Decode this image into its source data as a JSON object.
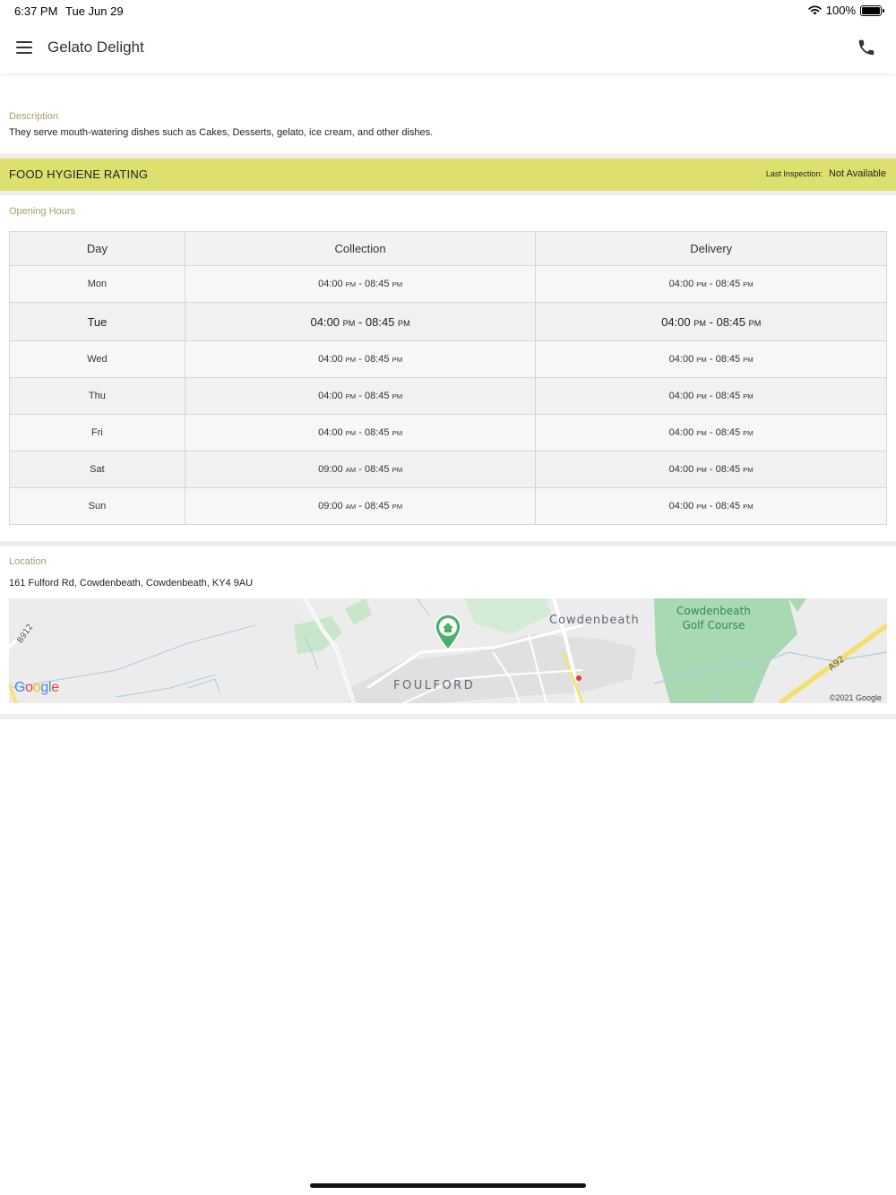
{
  "status_bar": {
    "time": "6:37 PM",
    "date": "Tue Jun 29",
    "battery": "100%",
    "battery_level": 1.0
  },
  "app_bar": {
    "title": "Gelato Delight",
    "menu_icon": "menu-icon",
    "phone_icon": "phone-icon"
  },
  "description": {
    "label": "Description",
    "text": "They serve mouth-watering dishes such as Cakes, Desserts, gelato, ice cream,  and other dishes."
  },
  "hygiene": {
    "title": "FOOD HYGIENE RATING",
    "last_inspection_label": "Last Inspection:",
    "last_inspection_value": "Not Available",
    "color": "#dde06c"
  },
  "opening_hours": {
    "label": "Opening Hours",
    "headers": [
      "Day",
      "Collection",
      "Delivery"
    ],
    "rows": [
      {
        "day": "Mon",
        "collection": {
          "open": "04:00",
          "open_ap": "PM",
          "close": "08:45",
          "close_ap": "PM"
        },
        "delivery": {
          "open": "04:00",
          "open_ap": "PM",
          "close": "08:45",
          "close_ap": "PM"
        }
      },
      {
        "day": "Tue",
        "collection": {
          "open": "04:00",
          "open_ap": "PM",
          "close": "08:45",
          "close_ap": "PM"
        },
        "delivery": {
          "open": "04:00",
          "open_ap": "PM",
          "close": "08:45",
          "close_ap": "PM"
        }
      },
      {
        "day": "Wed",
        "collection": {
          "open": "04:00",
          "open_ap": "PM",
          "close": "08:45",
          "close_ap": "PM"
        },
        "delivery": {
          "open": "04:00",
          "open_ap": "PM",
          "close": "08:45",
          "close_ap": "PM"
        }
      },
      {
        "day": "Thu",
        "collection": {
          "open": "04:00",
          "open_ap": "PM",
          "close": "08:45",
          "close_ap": "PM"
        },
        "delivery": {
          "open": "04:00",
          "open_ap": "PM",
          "close": "08:45",
          "close_ap": "PM"
        }
      },
      {
        "day": "Fri",
        "collection": {
          "open": "04:00",
          "open_ap": "PM",
          "close": "08:45",
          "close_ap": "PM"
        },
        "delivery": {
          "open": "04:00",
          "open_ap": "PM",
          "close": "08:45",
          "close_ap": "PM"
        }
      },
      {
        "day": "Sat",
        "collection": {
          "open": "09:00",
          "open_ap": "AM",
          "close": "08:45",
          "close_ap": "PM"
        },
        "delivery": {
          "open": "04:00",
          "open_ap": "PM",
          "close": "08:45",
          "close_ap": "PM"
        }
      },
      {
        "day": "Sun",
        "collection": {
          "open": "09:00",
          "open_ap": "AM",
          "close": "08:45",
          "close_ap": "PM"
        },
        "delivery": {
          "open": "04:00",
          "open_ap": "PM",
          "close": "08:45",
          "close_ap": "PM"
        }
      }
    ]
  },
  "location": {
    "label": "Location",
    "address": "161 Fulford Rd, Cowdenbeath, Cowdenbeath, KY4 9AU"
  },
  "map": {
    "labels": {
      "town": "Cowdenbeath",
      "area": "FOULFORD",
      "golf_line1": "Cowdenbeath",
      "golf_line2": "Golf Course",
      "road_b912": "B912",
      "road_a92": "A92"
    },
    "copyright": "©2021 Google",
    "logo": "Google",
    "marker_icon": "home-marker-icon",
    "marker_color": "#4caf6e"
  }
}
